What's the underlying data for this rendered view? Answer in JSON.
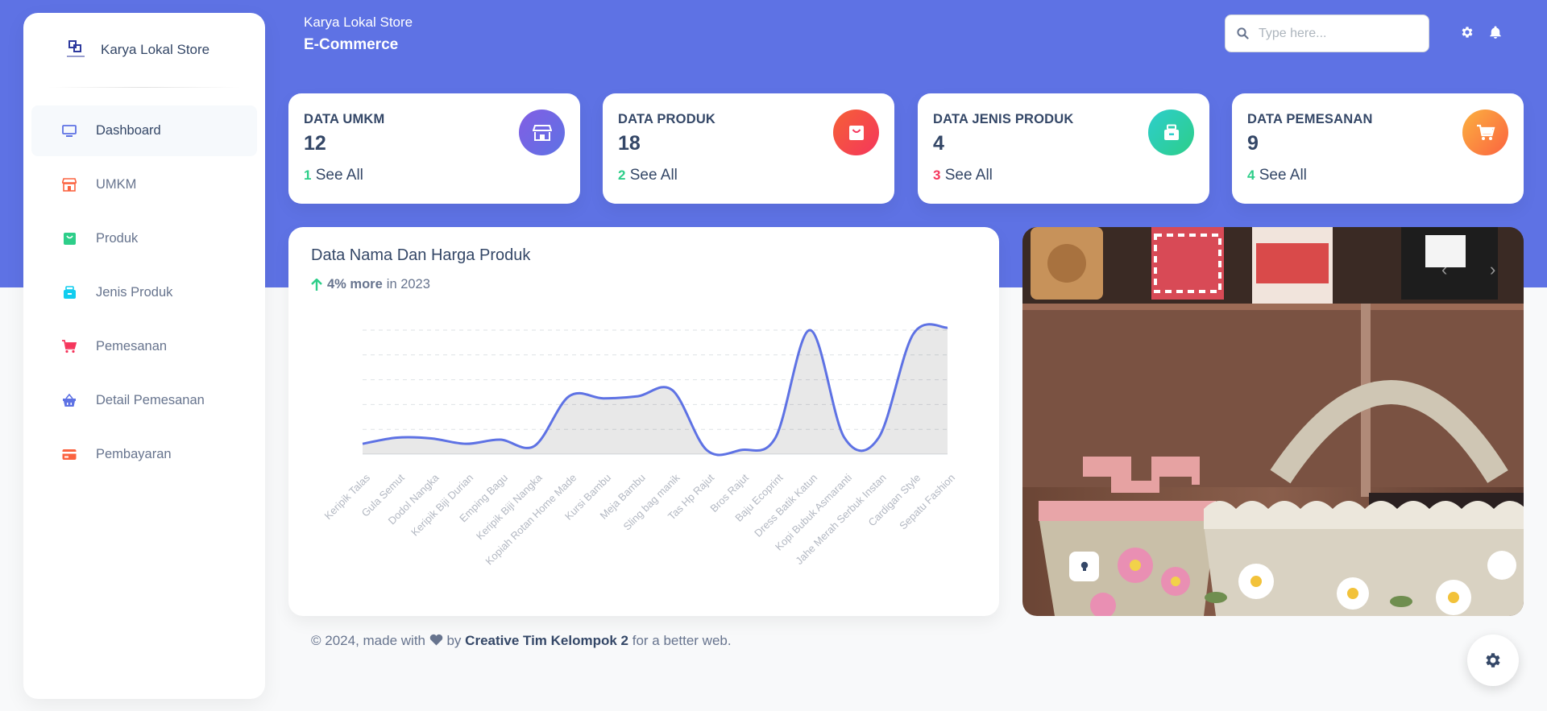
{
  "brand": {
    "name": "Karya Lokal Store",
    "logo": "store-logo"
  },
  "sidebar": {
    "items": [
      {
        "label": "Dashboard",
        "icon": "monitor-icon",
        "color": "#5e72e4",
        "active": true
      },
      {
        "label": "UMKM",
        "icon": "shop-icon",
        "color": "#fb6340"
      },
      {
        "label": "Produk",
        "icon": "bag-icon",
        "color": "#2dce89"
      },
      {
        "label": "Jenis Produk",
        "icon": "box-icon",
        "color": "#11cdef"
      },
      {
        "label": "Pemesanan",
        "icon": "cart-icon",
        "color": "#f5365c"
      },
      {
        "label": "Detail Pemesanan",
        "icon": "basket-icon",
        "color": "#5e72e4"
      },
      {
        "label": "Pembayaran",
        "icon": "credit-card-icon",
        "color": "#fb6340"
      }
    ]
  },
  "header": {
    "breadcrumb": "Karya Lokal Store",
    "title": "E-Commerce",
    "search_placeholder": "Type here...",
    "icons": [
      "search-icon",
      "gear-icon",
      "bell-icon"
    ]
  },
  "stats": [
    {
      "title": "DATA UMKM",
      "value": "12",
      "count": "1",
      "link": "See All",
      "icon": "shop-icon",
      "color": "#825ee4",
      "count_color": "#2dce89"
    },
    {
      "title": "DATA PRODUK",
      "value": "18",
      "count": "2",
      "link": "See All",
      "icon": "bag-icon",
      "color": "#f5365c",
      "count_color": "#2dce89"
    },
    {
      "title": "DATA JENIS PRODUK",
      "value": "4",
      "count": "3",
      "link": "See All",
      "icon": "box-icon",
      "color": "#2dcecc",
      "count_color": "#f5365c"
    },
    {
      "title": "DATA PEMESANAN",
      "value": "9",
      "count": "4",
      "link": "See All",
      "icon": "cart-icon",
      "color": "#fb8c3a",
      "count_color": "#2dce89"
    }
  ],
  "chart_card": {
    "title": "Data Nama Dan Harga Produk",
    "subtitle_strong": "4% more",
    "subtitle_rest": "in 2023"
  },
  "chart_data": {
    "type": "line",
    "fill": true,
    "color": "#5e72e4",
    "categories": [
      "Keripik Talas",
      "Gula Semut",
      "Dodol Nangka",
      "Keripik Biji Durian",
      "Emping Bagu",
      "Keripik Biji Nangka",
      "Kopiah Rotan Home Made",
      "Kursi Bambu",
      "Meja Bambu",
      "Sling bag manik",
      "Tas Hp Rajut",
      "Bros Rajut",
      "Baju Ecoprint",
      "Dress Batik Katun",
      "Kopi Bubuk Asmaranti",
      "Jahe Merah Serbuk Instan",
      "Cardigan Style",
      "Sepatu Fashion"
    ],
    "values": [
      25000,
      40000,
      38000,
      25000,
      35000,
      20000,
      140000,
      135000,
      140000,
      155000,
      10000,
      10000,
      40000,
      300000,
      40000,
      40000,
      290000,
      310000
    ],
    "ylim": [
      0,
      300000
    ],
    "grid": true,
    "title": "",
    "xlabel": "",
    "ylabel": ""
  },
  "footer": {
    "prefix": "© 2024, made with",
    "by": "by",
    "author": "Creative Tim Kelompok 2",
    "suffix": "for a better web."
  }
}
